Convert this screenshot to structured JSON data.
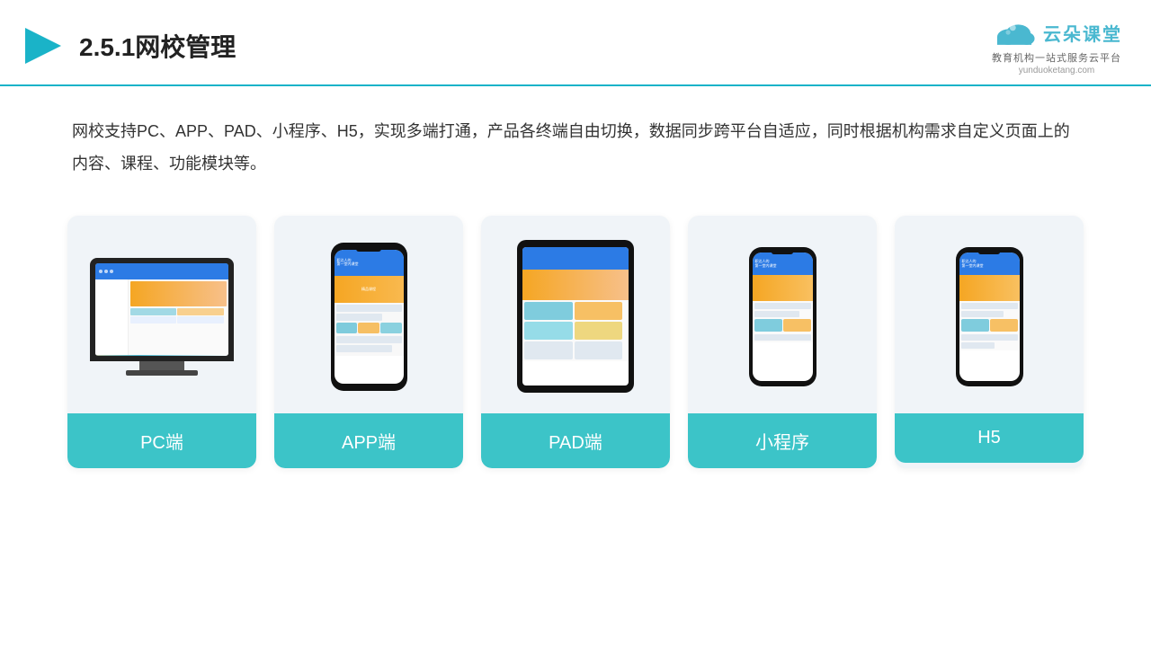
{
  "header": {
    "title": "2.5.1网校管理",
    "logo_name": "云朵课堂",
    "logo_url": "yunduoketang.com",
    "logo_tagline": "教育机构一站\n式服务云平台"
  },
  "description": "网校支持PC、APP、PAD、小程序、H5，实现多端打通，产品各终端自由切换，数据同步跨平台自适应，同时根据机构需求自定义页面上的内容、课程、功能模块等。",
  "cards": [
    {
      "id": "pc",
      "label": "PC端"
    },
    {
      "id": "app",
      "label": "APP端"
    },
    {
      "id": "pad",
      "label": "PAD端"
    },
    {
      "id": "miniprogram",
      "label": "小程序"
    },
    {
      "id": "h5",
      "label": "H5"
    }
  ]
}
